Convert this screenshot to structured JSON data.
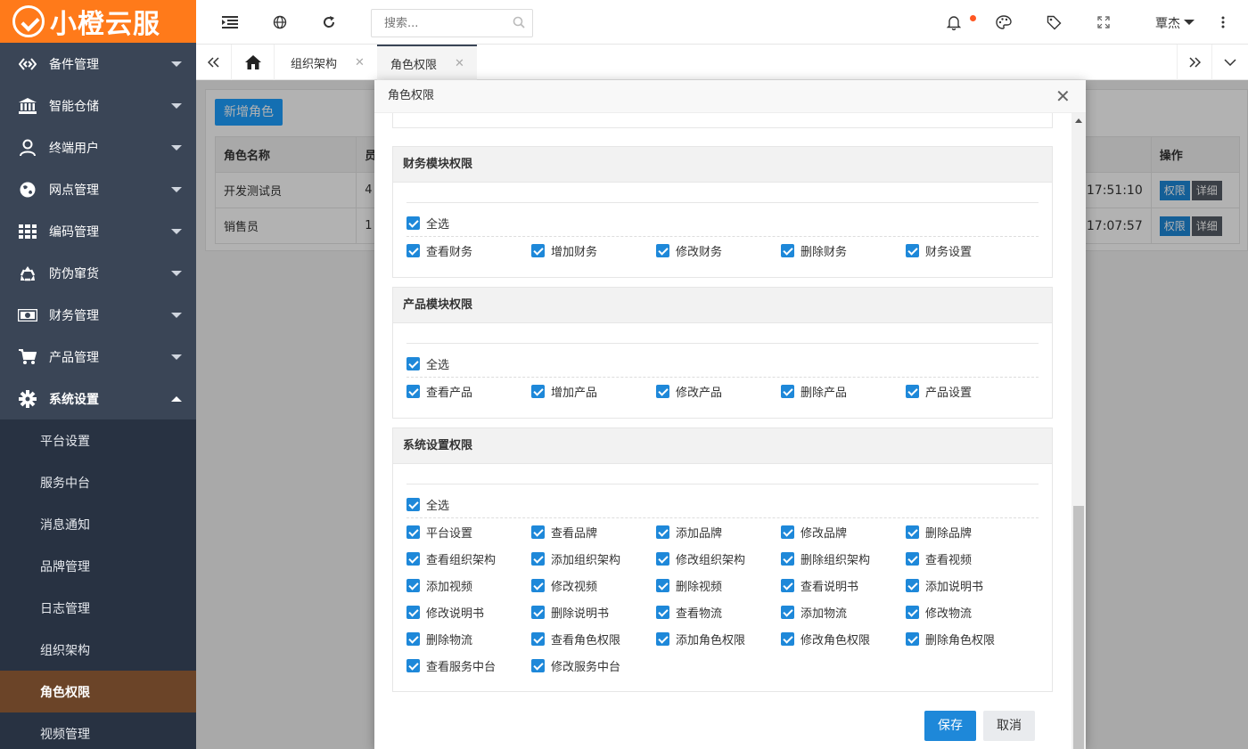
{
  "app": {
    "logo_text": "小橙云服"
  },
  "sidebar": {
    "menus": [
      {
        "label": "备件管理",
        "icon": "exchange-icon"
      },
      {
        "label": "智能仓储",
        "icon": "bank-icon"
      },
      {
        "label": "终端用户",
        "icon": "user-icon"
      },
      {
        "label": "网点管理",
        "icon": "globe-icon"
      },
      {
        "label": "编码管理",
        "icon": "grid-icon"
      },
      {
        "label": "防伪窜货",
        "icon": "recycle-icon"
      },
      {
        "label": "财务管理",
        "icon": "money-icon"
      },
      {
        "label": "产品管理",
        "icon": "cart-icon"
      },
      {
        "label": "系统设置",
        "icon": "gear-icon"
      }
    ],
    "sub_items": [
      "平台设置",
      "服务中台",
      "消息通知",
      "品牌管理",
      "日志管理",
      "组织架构",
      "角色权限",
      "视频管理"
    ],
    "active_sub": "角色权限"
  },
  "header": {
    "search_placeholder": "搜索...",
    "user_name": "覃杰"
  },
  "tabs": [
    {
      "label": "组织架构"
    },
    {
      "label": "角色权限"
    }
  ],
  "background": {
    "add_button": "新增角色",
    "columns": [
      "角色名称",
      "员",
      "操作"
    ],
    "rows": [
      {
        "name": "开发测试员",
        "col2": "4",
        "time": "0 17:51:10"
      },
      {
        "name": "销售员",
        "col2": "1",
        "time": "0 17:07:57"
      }
    ],
    "action_perm": "权限",
    "action_detail": "详细"
  },
  "modal": {
    "title": "角色权限",
    "select_all": "全选",
    "finance": {
      "title": "财务模块权限",
      "items": [
        "查看财务",
        "增加财务",
        "修改财务",
        "删除财务",
        "财务设置"
      ]
    },
    "product": {
      "title": "产品模块权限",
      "items": [
        "查看产品",
        "增加产品",
        "修改产品",
        "删除产品",
        "产品设置"
      ]
    },
    "system": {
      "title": "系统设置权限",
      "items": [
        "平台设置",
        "查看品牌",
        "添加品牌",
        "修改品牌",
        "删除品牌",
        "查看组织架构",
        "添加组织架构",
        "修改组织架构",
        "删除组织架构",
        "查看视频",
        "添加视频",
        "修改视频",
        "删除视频",
        "查看说明书",
        "添加说明书",
        "修改说明书",
        "删除说明书",
        "查看物流",
        "添加物流",
        "修改物流",
        "删除物流",
        "查看角色权限",
        "添加角色权限",
        "修改角色权限",
        "删除角色权限",
        "查看服务中台",
        "修改服务中台"
      ]
    },
    "save": "保存",
    "cancel": "取消"
  },
  "colors": {
    "brand": "#ff7a1a",
    "primary": "#1e88d9",
    "sidebar": "#3a4556",
    "active_sub": "#6b4428"
  }
}
